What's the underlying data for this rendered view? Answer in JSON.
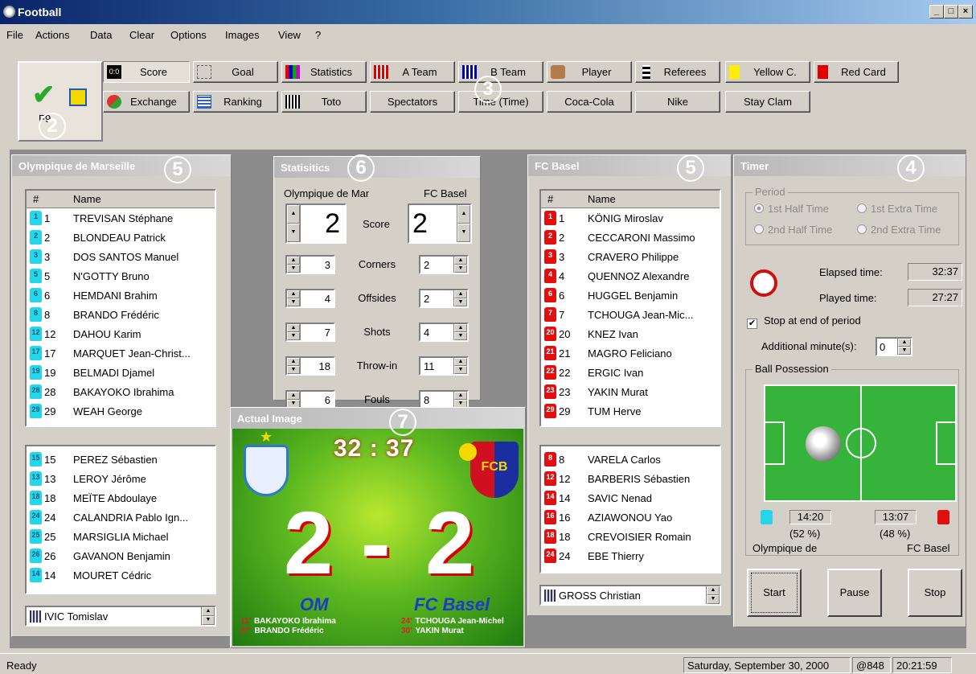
{
  "window": {
    "title": "Football",
    "min": "_",
    "max": "□",
    "close": "×"
  },
  "menu": [
    "File",
    "Actions",
    "Data",
    "Clear",
    "Options",
    "Images",
    "View",
    "?"
  ],
  "toolbar": {
    "row1": [
      "Score",
      "Goal",
      "Statistics",
      "A Team",
      "B Team",
      "Player",
      "Referees",
      "Yellow C.",
      "Red Card"
    ],
    "row2": [
      "Exchange",
      "Ranking",
      "Toto",
      "Spectators",
      "Time (Time)",
      "Coca-Cola",
      "Nike",
      "Stay Clam"
    ],
    "score_icon_text": "0:0",
    "big_icon_label": "F9"
  },
  "badges": {
    "b2": "2",
    "b3": "3",
    "b4": "4",
    "b5a": "5",
    "b5b": "5",
    "b6": "6",
    "b7": "7"
  },
  "team_a": {
    "title": "Olympique de Marseille",
    "col_num": "#",
    "col_name": "Name",
    "players": [
      {
        "num": "1",
        "name": "TREVISAN Stéphane"
      },
      {
        "num": "2",
        "name": "BLONDEAU Patrick"
      },
      {
        "num": "3",
        "name": "DOS SANTOS Manuel"
      },
      {
        "num": "5",
        "name": "N'GOTTY Bruno"
      },
      {
        "num": "6",
        "name": "HEMDANI Brahim"
      },
      {
        "num": "8",
        "name": "BRANDO Frédéric"
      },
      {
        "num": "12",
        "name": "DAHOU Karim"
      },
      {
        "num": "17",
        "name": "MARQUET Jean-Christ..."
      },
      {
        "num": "19",
        "name": "BELMADI Djamel"
      },
      {
        "num": "28",
        "name": "BAKAYOKO Ibrahima"
      },
      {
        "num": "29",
        "name": "WEAH George"
      }
    ],
    "subs": [
      {
        "num": "15",
        "name": "PEREZ Sébastien"
      },
      {
        "num": "13",
        "name": "LEROY Jérôme"
      },
      {
        "num": "18",
        "name": "MEÏTE Abdoulaye"
      },
      {
        "num": "24",
        "name": "CALANDRIA Pablo Ign..."
      },
      {
        "num": "25",
        "name": "MARSIGLIA Michael"
      },
      {
        "num": "26",
        "name": "GAVANON Benjamin"
      },
      {
        "num": "14",
        "name": "MOURET Cédric"
      }
    ],
    "coach": "IVIC Tomislav"
  },
  "team_b": {
    "title": "FC Basel",
    "col_num": "#",
    "col_name": "Name",
    "players": [
      {
        "num": "1",
        "name": "KÖNIG Miroslav"
      },
      {
        "num": "2",
        "name": "CECCARONI Massimo"
      },
      {
        "num": "3",
        "name": "CRAVERO Philippe"
      },
      {
        "num": "4",
        "name": "QUENNOZ Alexandre"
      },
      {
        "num": "6",
        "name": "HUGGEL Benjamin"
      },
      {
        "num": "7",
        "name": "TCHOUGA Jean-Mic..."
      },
      {
        "num": "20",
        "name": "KNEZ Ivan"
      },
      {
        "num": "21",
        "name": "MAGRO Feliciano"
      },
      {
        "num": "22",
        "name": "ERGIC Ivan"
      },
      {
        "num": "23",
        "name": "YAKIN Murat"
      },
      {
        "num": "29",
        "name": "TUM Herve"
      }
    ],
    "subs": [
      {
        "num": "8",
        "name": "VARELA Carlos"
      },
      {
        "num": "12",
        "name": "BARBERIS Sébastien"
      },
      {
        "num": "14",
        "name": "SAVIC Nenad"
      },
      {
        "num": "16",
        "name": "AZIAWONOU Yao"
      },
      {
        "num": "18",
        "name": "CREVOISIER Romain"
      },
      {
        "num": "24",
        "name": "EBE Thierry"
      }
    ],
    "coach": "GROSS Christian"
  },
  "stats": {
    "title": "Statisitics",
    "team_a": "Olympique de Mar",
    "team_b": "FC Basel",
    "score_label": "Score",
    "score_a": "2",
    "score_b": "2",
    "rows": [
      {
        "label": "Corners",
        "a": "3",
        "b": "2"
      },
      {
        "label": "Offsides",
        "a": "4",
        "b": "2"
      },
      {
        "label": "Shots",
        "a": "7",
        "b": "4"
      },
      {
        "label": "Throw-in",
        "a": "18",
        "b": "11"
      },
      {
        "label": "Fouls",
        "a": "6",
        "b": "8"
      }
    ]
  },
  "actual_image": {
    "title": "Actual Image",
    "clock": "32 : 37",
    "score_a": "2",
    "dash": "-",
    "score_b": "2",
    "team_a": "OM",
    "team_b": "FC Basel",
    "scorers_a": [
      {
        "min": "11'",
        "name": "BAKAYOKO Ibrahima"
      },
      {
        "min": "27'",
        "name": "BRANDO Frédéric"
      }
    ],
    "scorers_b": [
      {
        "min": "24'",
        "name": "TCHOUGA Jean-Michel"
      },
      {
        "min": "30'",
        "name": "YAKIN Murat"
      }
    ],
    "crest_b": "FCB"
  },
  "timer": {
    "title": "Timer",
    "period_label": "Period",
    "periods": [
      "1st Half Time",
      "1st Extra Time",
      "2nd Half Time",
      "2nd Extra Time"
    ],
    "elapsed_label": "Elapsed time:",
    "elapsed": "32:37",
    "played_label": "Played time:",
    "played": "27:27",
    "stop_end_label": "Stop at end of period",
    "additional_label": "Additional minute(s):",
    "additional": "0",
    "possession_label": "Ball Possession",
    "poss_a_time": "14:20",
    "poss_a_pct": "(52 %)",
    "poss_b_time": "13:07",
    "poss_b_pct": "(48 %)",
    "team_a": "Olympique de",
    "team_b": "FC Basel",
    "start": "Start",
    "pause": "Pause",
    "stop": "Stop"
  },
  "status": {
    "ready": "Ready",
    "date": "Saturday, September 30, 2000",
    "beat": "@848",
    "time": "20:21:59"
  },
  "colors": {
    "team_a_shirt": "#26d5e8",
    "team_b_shirt": "#e01010",
    "title_blue": "#0a246a"
  }
}
